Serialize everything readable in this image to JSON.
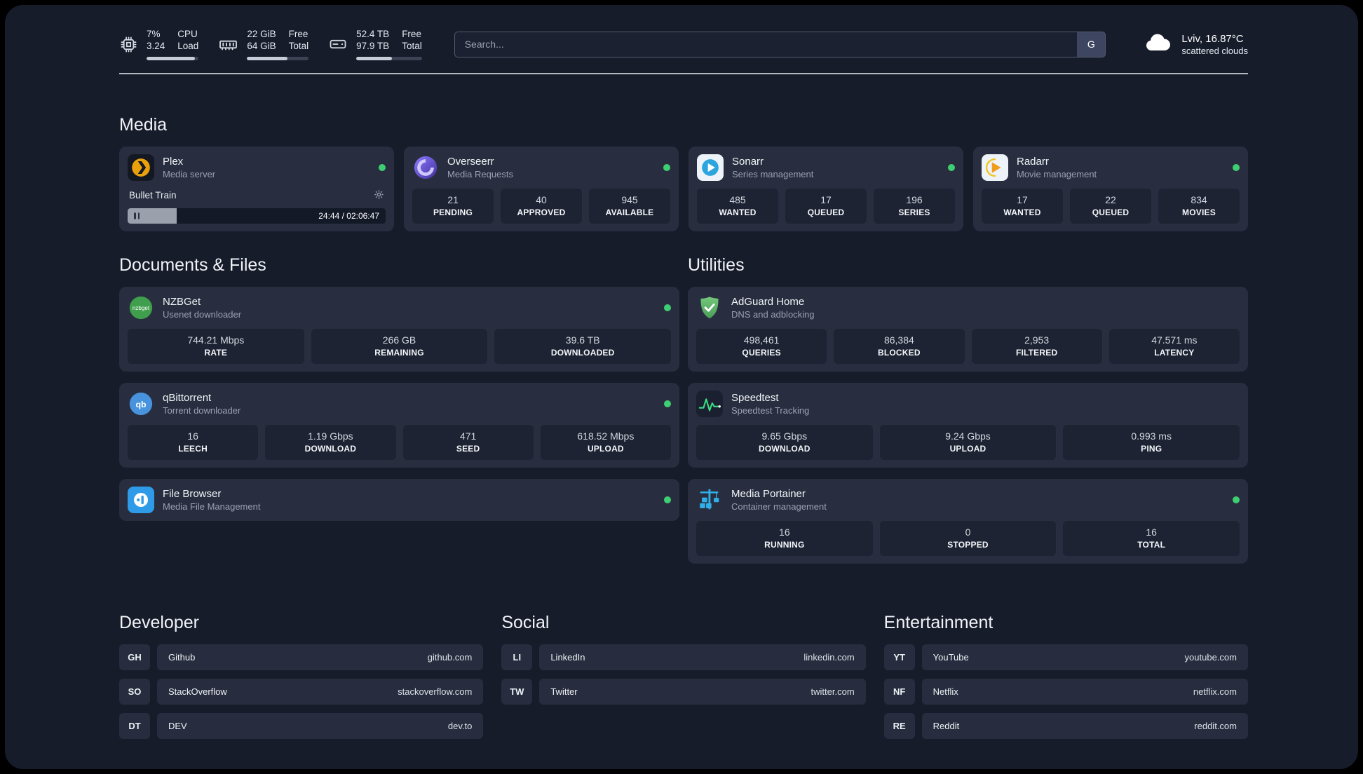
{
  "header": {
    "cpu": {
      "value_top": "7%",
      "value_bottom": "3.24",
      "label_top": "CPU",
      "label_bottom": "Load",
      "progress": 93
    },
    "ram": {
      "value_top": "22 GiB",
      "value_bottom": "64 GiB",
      "label_top": "Free",
      "label_bottom": "Total",
      "progress": 66
    },
    "disk": {
      "value_top": "52.4 TB",
      "value_bottom": "97.9 TB",
      "label_top": "Free",
      "label_bottom": "Total",
      "progress": 54
    },
    "search": {
      "placeholder": "Search...",
      "button_label": "G"
    },
    "weather": {
      "location": "Lviv, 16.87°C",
      "condition": "scattered clouds"
    }
  },
  "media": {
    "title": "Media",
    "plex": {
      "name": "Plex",
      "subtitle": "Media server",
      "now_playing": "Bullet Train",
      "time": "24:44 / 02:06:47",
      "progress": 19
    },
    "overseerr": {
      "name": "Overseerr",
      "subtitle": "Media Requests",
      "stats": [
        {
          "value": "21",
          "label": "PENDING"
        },
        {
          "value": "40",
          "label": "APPROVED"
        },
        {
          "value": "945",
          "label": "AVAILABLE"
        }
      ]
    },
    "sonarr": {
      "name": "Sonarr",
      "subtitle": "Series management",
      "stats": [
        {
          "value": "485",
          "label": "WANTED"
        },
        {
          "value": "17",
          "label": "QUEUED"
        },
        {
          "value": "196",
          "label": "SERIES"
        }
      ]
    },
    "radarr": {
      "name": "Radarr",
      "subtitle": "Movie management",
      "stats": [
        {
          "value": "17",
          "label": "WANTED"
        },
        {
          "value": "22",
          "label": "QUEUED"
        },
        {
          "value": "834",
          "label": "MOVIES"
        }
      ]
    }
  },
  "documents": {
    "title": "Documents & Files",
    "nzbget": {
      "name": "NZBGet",
      "subtitle": "Usenet downloader",
      "stats": [
        {
          "value": "744.21 Mbps",
          "label": "RATE"
        },
        {
          "value": "266 GB",
          "label": "REMAINING"
        },
        {
          "value": "39.6 TB",
          "label": "DOWNLOADED"
        }
      ]
    },
    "qbittorrent": {
      "name": "qBittorrent",
      "subtitle": "Torrent downloader",
      "stats": [
        {
          "value": "16",
          "label": "LEECH"
        },
        {
          "value": "1.19 Gbps",
          "label": "DOWNLOAD"
        },
        {
          "value": "471",
          "label": "SEED"
        },
        {
          "value": "618.52 Mbps",
          "label": "UPLOAD"
        }
      ]
    },
    "filebrowser": {
      "name": "File Browser",
      "subtitle": "Media File Management"
    }
  },
  "utilities": {
    "title": "Utilities",
    "adguard": {
      "name": "AdGuard Home",
      "subtitle": "DNS and adblocking",
      "stats": [
        {
          "value": "498,461",
          "label": "QUERIES"
        },
        {
          "value": "86,384",
          "label": "BLOCKED"
        },
        {
          "value": "2,953",
          "label": "FILTERED"
        },
        {
          "value": "47.571 ms",
          "label": "LATENCY"
        }
      ]
    },
    "speedtest": {
      "name": "Speedtest",
      "subtitle": "Speedtest Tracking",
      "stats": [
        {
          "value": "9.65 Gbps",
          "label": "DOWNLOAD"
        },
        {
          "value": "9.24 Gbps",
          "label": "UPLOAD"
        },
        {
          "value": "0.993 ms",
          "label": "PING"
        }
      ]
    },
    "portainer": {
      "name": "Media Portainer",
      "subtitle": "Container management",
      "stats": [
        {
          "value": "16",
          "label": "RUNNING"
        },
        {
          "value": "0",
          "label": "STOPPED"
        },
        {
          "value": "16",
          "label": "TOTAL"
        }
      ]
    }
  },
  "bookmarks": {
    "developer": {
      "title": "Developer",
      "items": [
        {
          "abbr": "GH",
          "name": "Github",
          "url": "github.com"
        },
        {
          "abbr": "SO",
          "name": "StackOverflow",
          "url": "stackoverflow.com"
        },
        {
          "abbr": "DT",
          "name": "DEV",
          "url": "dev.to"
        }
      ]
    },
    "social": {
      "title": "Social",
      "items": [
        {
          "abbr": "LI",
          "name": "LinkedIn",
          "url": "linkedin.com"
        },
        {
          "abbr": "TW",
          "name": "Twitter",
          "url": "twitter.com"
        }
      ]
    },
    "entertainment": {
      "title": "Entertainment",
      "items": [
        {
          "abbr": "YT",
          "name": "YouTube",
          "url": "youtube.com"
        },
        {
          "abbr": "NF",
          "name": "Netflix",
          "url": "netflix.com"
        },
        {
          "abbr": "RE",
          "name": "Reddit",
          "url": "reddit.com"
        }
      ]
    }
  },
  "colors": {
    "status_green": "#3ecf72",
    "card_bg": "#282e3f",
    "tile_bg": "#1d2332",
    "page_bg": "#171c2b"
  }
}
